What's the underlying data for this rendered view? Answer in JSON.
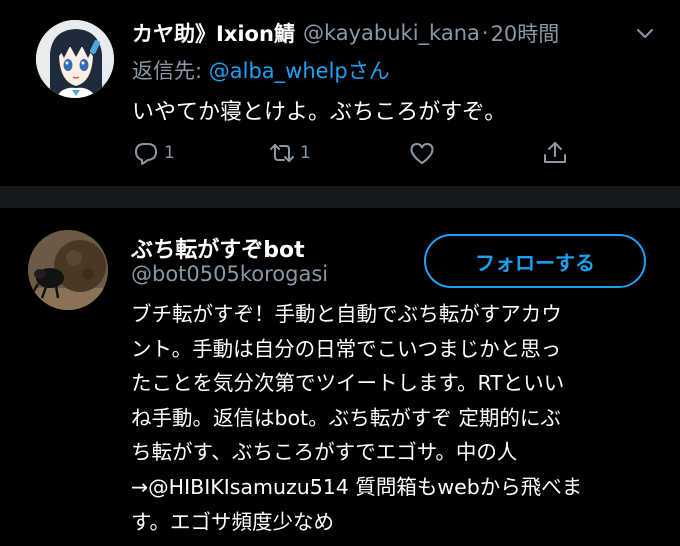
{
  "tweet": {
    "display_name": "カヤ助》Ixion鯖",
    "handle": "@kayabuki_kana",
    "separator": "·",
    "time": "20時間",
    "reply_prefix": "返信先: ",
    "reply_mention": "@alba_whelp",
    "reply_suffix": "さん",
    "text": "いやてか寝とけよ。ぶちころがすぞ。",
    "actions": {
      "reply_count": "1",
      "retweet_count": "1",
      "like_count": "",
      "share_count": ""
    }
  },
  "user_card": {
    "name": "ぶち転がすぞbot",
    "handle": "@bot0505korogasi",
    "follow_label": "フォローする",
    "bio_lines": [
      "ブチ転がすぞ！手動と自動でぶち転がすアカウ",
      "ント。手動は自分の日常でこいつまじかと思っ",
      "たことを気分次第でツイートします。RTといい",
      "ね手動。返信はbot。ぶち転がすぞ 定期的にぶ",
      "ち転がす、ぶちころがすでエゴサ。中の人",
      "→@HIBIKIsamuzu514 質問箱もwebから飛べま",
      "す。エゴサ頻度少なめ"
    ]
  },
  "colors": {
    "background": "#000000",
    "secondary_text": "#8899a6",
    "accent": "#1da1f2",
    "divider": "#15181c"
  },
  "icons": {
    "reply": "speech-bubble-icon",
    "retweet": "retweet-arrows-icon",
    "like": "heart-icon",
    "share": "share-upload-icon",
    "menu": "chevron-down-icon"
  }
}
